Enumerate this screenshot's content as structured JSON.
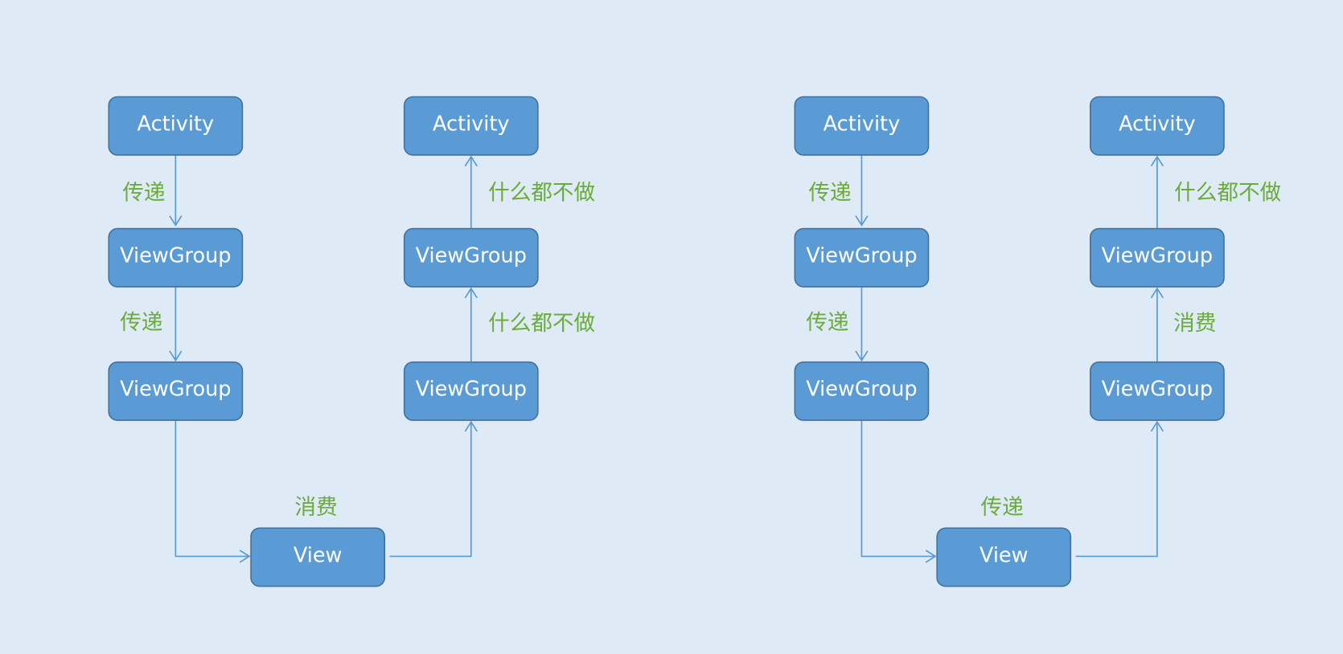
{
  "colors": {
    "background": "#deebf6",
    "node_fill": "#5b9bd5",
    "node_border": "#41719c",
    "edge": "#5b9bd5",
    "label": "#6aab3c"
  },
  "diagrams": [
    {
      "nodes": {
        "down_activity": "Activity",
        "down_viewgroup_1": "ViewGroup",
        "down_viewgroup_2": "ViewGroup",
        "view": "View",
        "up_viewgroup_2": "ViewGroup",
        "up_viewgroup_1": "ViewGroup",
        "up_activity": "Activity"
      },
      "edge_labels": {
        "activity_to_viewgroup": "传递",
        "viewgroup_to_viewgroup": "传递",
        "view": "消费",
        "viewgroup_up": "什么都不做",
        "activity_up": "什么都不做"
      }
    },
    {
      "nodes": {
        "down_activity": "Activity",
        "down_viewgroup_1": "ViewGroup",
        "down_viewgroup_2": "ViewGroup",
        "view": "View",
        "up_viewgroup_2": "ViewGroup",
        "up_viewgroup_1": "ViewGroup",
        "up_activity": "Activity"
      },
      "edge_labels": {
        "activity_to_viewgroup": "传递",
        "viewgroup_to_viewgroup": "传递",
        "view": "传递",
        "viewgroup_up": "消费",
        "activity_up": "什么都不做"
      }
    }
  ]
}
